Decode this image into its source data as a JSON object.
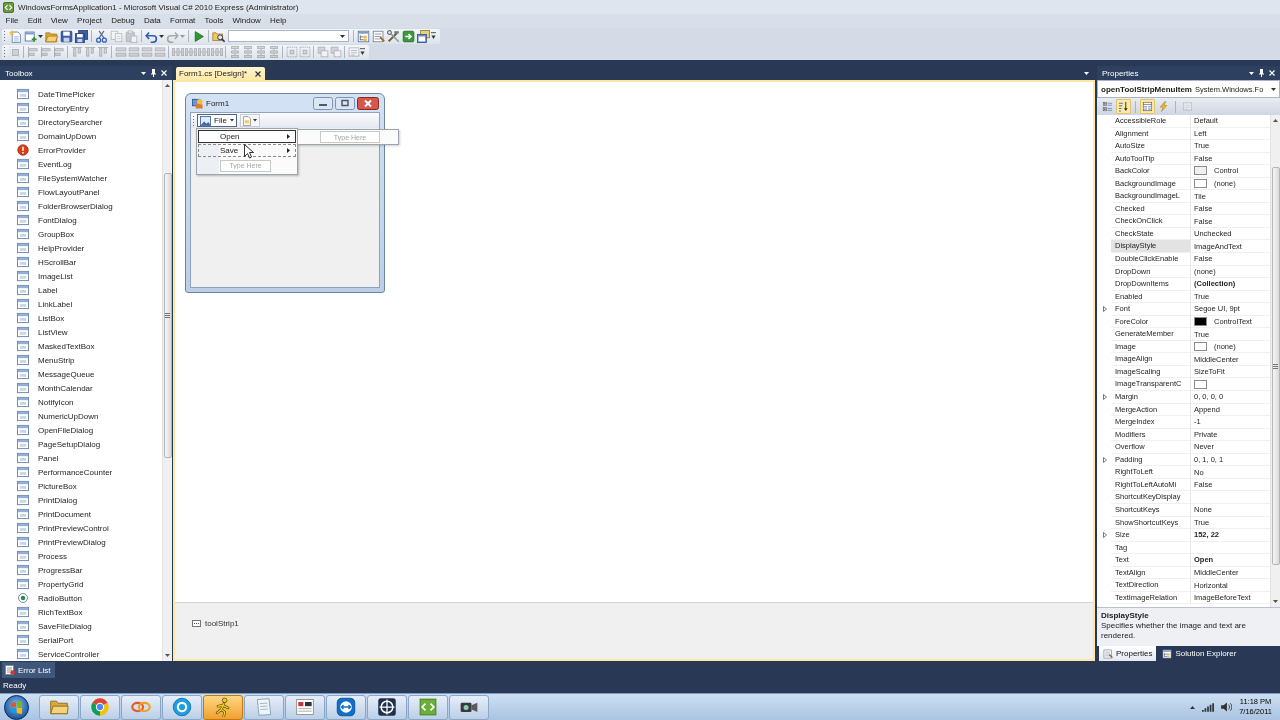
{
  "window": {
    "title": "WindowsFormsApplication1 - Microsoft Visual C# 2010 Express (Administrator)"
  },
  "menu": [
    "File",
    "Edit",
    "View",
    "Project",
    "Debug",
    "Data",
    "Format",
    "Tools",
    "Window",
    "Help"
  ],
  "toolbars": [
    {
      "groups": [
        {
          "buttons": [
            {
              "kind": "newproject",
              "disabled": false
            },
            {
              "kind": "additem",
              "disabled": false
            },
            {
              "kind": "caret",
              "disabled": false
            },
            {
              "kind": "open",
              "disabled": false
            },
            {
              "kind": "save",
              "disabled": false
            },
            {
              "kind": "saveall",
              "disabled": false
            }
          ]
        },
        {
          "buttons": [
            {
              "kind": "cut",
              "disabled": false
            },
            {
              "kind": "copy",
              "disabled": true
            },
            {
              "kind": "paste",
              "disabled": true
            }
          ]
        },
        {
          "buttons": [
            {
              "kind": "undo",
              "disabled": false
            },
            {
              "kind": "caret",
              "disabled": false
            },
            {
              "kind": "redo",
              "disabled": true
            },
            {
              "kind": "caret",
              "disabled": true
            }
          ]
        },
        {
          "buttons": [
            {
              "kind": "start",
              "disabled": false
            }
          ]
        },
        {
          "buttons": [
            {
              "kind": "findfiles",
              "disabled": false
            },
            {
              "kind": "combo",
              "disabled": false
            }
          ]
        },
        {
          "buttons": [
            {
              "kind": "solution",
              "disabled": false
            },
            {
              "kind": "properties",
              "disabled": false
            },
            {
              "kind": "toolbox",
              "disabled": false
            },
            {
              "kind": "extensions",
              "disabled": false
            },
            {
              "kind": "startpage",
              "disabled": false
            },
            {
              "kind": "overflow",
              "disabled": false
            }
          ]
        }
      ]
    },
    {
      "groups": [
        {
          "buttons": [
            {
              "kind": "grid",
              "disabled": true
            }
          ]
        },
        {
          "buttons": [
            {
              "kind": "align",
              "disabled": true
            },
            {
              "kind": "align",
              "disabled": true
            },
            {
              "kind": "align",
              "disabled": true
            }
          ]
        },
        {
          "buttons": [
            {
              "kind": "valign",
              "disabled": true
            },
            {
              "kind": "valign",
              "disabled": true
            },
            {
              "kind": "valign",
              "disabled": true
            }
          ]
        },
        {
          "buttons": [
            {
              "kind": "size",
              "disabled": true
            },
            {
              "kind": "size",
              "disabled": true
            },
            {
              "kind": "size",
              "disabled": true
            },
            {
              "kind": "size",
              "disabled": true
            }
          ]
        },
        {
          "buttons": [
            {
              "kind": "hspace",
              "disabled": true
            },
            {
              "kind": "hspace",
              "disabled": true
            },
            {
              "kind": "hspace",
              "disabled": true
            },
            {
              "kind": "hspace",
              "disabled": true
            }
          ]
        },
        {
          "buttons": [
            {
              "kind": "vspace",
              "disabled": true
            },
            {
              "kind": "vspace",
              "disabled": true
            },
            {
              "kind": "vspace",
              "disabled": true
            },
            {
              "kind": "vspace",
              "disabled": true
            }
          ]
        },
        {
          "buttons": [
            {
              "kind": "center",
              "disabled": true
            },
            {
              "kind": "center",
              "disabled": true
            }
          ]
        },
        {
          "buttons": [
            {
              "kind": "order",
              "disabled": true
            },
            {
              "kind": "order",
              "disabled": true
            }
          ]
        },
        {
          "buttons": [
            {
              "kind": "taborder",
              "disabled": true
            },
            {
              "kind": "overflow",
              "disabled": false
            }
          ]
        }
      ]
    }
  ],
  "toolbox": {
    "title": "Toolbox",
    "items": [
      {
        "label": "DateTimePicker"
      },
      {
        "label": "DirectoryEntry"
      },
      {
        "label": "DirectorySearcher"
      },
      {
        "label": "DomainUpDown"
      },
      {
        "label": "ErrorProvider"
      },
      {
        "label": "EventLog"
      },
      {
        "label": "FileSystemWatcher"
      },
      {
        "label": "FlowLayoutPanel"
      },
      {
        "label": "FolderBrowserDialog"
      },
      {
        "label": "FontDialog"
      },
      {
        "label": "GroupBox"
      },
      {
        "label": "HelpProvider"
      },
      {
        "label": "HScrollBar"
      },
      {
        "label": "ImageList"
      },
      {
        "label": "Label"
      },
      {
        "label": "LinkLabel"
      },
      {
        "label": "ListBox"
      },
      {
        "label": "ListView"
      },
      {
        "label": "MaskedTextBox"
      },
      {
        "label": "MenuStrip"
      },
      {
        "label": "MessageQueue"
      },
      {
        "label": "MonthCalendar"
      },
      {
        "label": "NotifyIcon"
      },
      {
        "label": "NumericUpDown"
      },
      {
        "label": "OpenFileDialog"
      },
      {
        "label": "PageSetupDialog"
      },
      {
        "label": "Panel"
      },
      {
        "label": "PerformanceCounter"
      },
      {
        "label": "PictureBox"
      },
      {
        "label": "PrintDialog"
      },
      {
        "label": "PrintDocument"
      },
      {
        "label": "PrintPreviewControl"
      },
      {
        "label": "PrintPreviewDialog"
      },
      {
        "label": "Process"
      },
      {
        "label": "ProgressBar"
      },
      {
        "label": "PropertyGrid"
      },
      {
        "label": "RadioButton"
      },
      {
        "label": "RichTextBox"
      },
      {
        "label": "SaveFileDialog"
      },
      {
        "label": "SerialPort"
      },
      {
        "label": "ServiceController"
      }
    ]
  },
  "document_tabs": [
    {
      "label": "Form1.cs [Design]*",
      "selected": true
    }
  ],
  "designer": {
    "form": {
      "title": "Form1",
      "menu_strip": {
        "items": [
          {
            "label": "File",
            "selected": true,
            "dropdown": {
              "items": [
                {
                  "label": "Open",
                  "selected": true,
                  "hovered": false,
                  "expanded": true,
                  "submenu_placeholder": "Type Here"
                },
                {
                  "label": "Save",
                  "selected": false,
                  "hovered": true,
                  "expanded": false
                }
              ],
              "placeholder": "Type Here"
            }
          }
        ]
      }
    },
    "tray": [
      {
        "label": "toolStrip1"
      }
    ]
  },
  "properties": {
    "title": "Properties",
    "object": {
      "name": "openToolStripMenuItem",
      "type": "System.Windows.Fo"
    },
    "toolbar": [
      {
        "kind": "categorized",
        "selected": false,
        "disabled": false
      },
      {
        "kind": "alphabetical",
        "selected": true,
        "disabled": false
      },
      {
        "kind": "properties",
        "selected": true,
        "disabled": false
      },
      {
        "kind": "events",
        "selected": false,
        "disabled": false
      },
      {
        "kind": "pages",
        "selected": false,
        "disabled": true
      }
    ],
    "rows": [
      {
        "name": "AccessibleRole",
        "value": "Default",
        "selected": false,
        "modified": false,
        "expandable": false
      },
      {
        "name": "Alignment",
        "value": "Left",
        "selected": false,
        "modified": false,
        "expandable": false
      },
      {
        "name": "AutoSize",
        "value": "True",
        "selected": false,
        "modified": false,
        "expandable": false
      },
      {
        "name": "AutoToolTip",
        "value": "False",
        "selected": false,
        "modified": false,
        "expandable": false
      },
      {
        "name": "BackColor",
        "value": "Control",
        "color": "#f0f0f0",
        "selected": false,
        "modified": false,
        "expandable": false
      },
      {
        "name": "BackgroundImage",
        "value": "(none)",
        "color": "#ffffff",
        "selected": false,
        "modified": false,
        "expandable": false
      },
      {
        "name": "BackgroundImageL",
        "value": "Tile",
        "selected": false,
        "modified": false,
        "expandable": false
      },
      {
        "name": "Checked",
        "value": "False",
        "selected": false,
        "modified": false,
        "expandable": false
      },
      {
        "name": "CheckOnClick",
        "value": "False",
        "selected": false,
        "modified": false,
        "expandable": false
      },
      {
        "name": "CheckState",
        "value": "Unchecked",
        "selected": false,
        "modified": false,
        "expandable": false
      },
      {
        "name": "DisplayStyle",
        "value": "ImageAndText",
        "selected": true,
        "modified": false,
        "expandable": false
      },
      {
        "name": "DoubleClickEnable",
        "value": "False",
        "selected": false,
        "modified": false,
        "expandable": false
      },
      {
        "name": "DropDown",
        "value": "(none)",
        "selected": false,
        "modified": false,
        "expandable": false
      },
      {
        "name": "DropDownItems",
        "value": "(Collection)",
        "selected": false,
        "modified": true,
        "expandable": false
      },
      {
        "name": "Enabled",
        "value": "True",
        "selected": false,
        "modified": false,
        "expandable": false
      },
      {
        "name": "Font",
        "value": "Segoe UI, 9pt",
        "selected": false,
        "modified": false,
        "expandable": true
      },
      {
        "name": "ForeColor",
        "value": "ControlText",
        "color": "#000000",
        "selected": false,
        "modified": false,
        "expandable": false
      },
      {
        "name": "GenerateMember",
        "value": "True",
        "selected": false,
        "modified": false,
        "expandable": false
      },
      {
        "name": "Image",
        "value": "(none)",
        "color": "#ffffff",
        "selected": false,
        "modified": false,
        "expandable": false
      },
      {
        "name": "ImageAlign",
        "value": "MiddleCenter",
        "selected": false,
        "modified": false,
        "expandable": false
      },
      {
        "name": "ImageScaling",
        "value": "SizeToFit",
        "selected": false,
        "modified": false,
        "expandable": false
      },
      {
        "name": "ImageTransparentC",
        "color": "#ffffff",
        "selected": false,
        "expandable": false
      },
      {
        "name": "Margin",
        "value": "0, 0, 0, 0",
        "selected": false,
        "modified": false,
        "expandable": true
      },
      {
        "name": "MergeAction",
        "value": "Append",
        "selected": false,
        "modified": false,
        "expandable": false
      },
      {
        "name": "MergeIndex",
        "value": "-1",
        "selected": false,
        "modified": false,
        "expandable": false
      },
      {
        "name": "Modifiers",
        "value": "Private",
        "selected": false,
        "modified": false,
        "expandable": false
      },
      {
        "name": "Overflow",
        "value": "Never",
        "selected": false,
        "modified": false,
        "expandable": false
      },
      {
        "name": "Padding",
        "value": "0, 1, 0, 1",
        "selected": false,
        "modified": false,
        "expandable": true
      },
      {
        "name": "RightToLeft",
        "value": "No",
        "selected": false,
        "modified": false,
        "expandable": false
      },
      {
        "name": "RightToLeftAutoMi",
        "value": "False",
        "selected": false,
        "modified": false,
        "expandable": false
      },
      {
        "name": "ShortcutKeyDisplay",
        "selected": false,
        "expandable": false
      },
      {
        "name": "ShortcutKeys",
        "value": "None",
        "selected": false,
        "modified": false,
        "expandable": false
      },
      {
        "name": "ShowShortcutKeys",
        "value": "True",
        "selected": false,
        "modified": false,
        "expandable": false
      },
      {
        "name": "Size",
        "value": "152, 22",
        "selected": false,
        "modified": true,
        "expandable": true
      },
      {
        "name": "Tag",
        "selected": false,
        "expandable": false
      },
      {
        "name": "Text",
        "value": "Open",
        "selected": false,
        "modified": true,
        "expandable": false
      },
      {
        "name": "TextAlign",
        "value": "MiddleCenter",
        "selected": false,
        "modified": false,
        "expandable": false
      },
      {
        "name": "TextDirection",
        "value": "Horizontal",
        "selected": false,
        "modified": false,
        "expandable": false
      },
      {
        "name": "TextImageRelation",
        "value": "ImageBeforeText",
        "selected": false,
        "modified": false,
        "expandable": false
      }
    ],
    "description": {
      "title": "DisplayStyle",
      "text": "Specifies whether the image and text are rendered."
    },
    "tabs": [
      {
        "label": "Properties",
        "selected": true
      },
      {
        "label": "Solution Explorer",
        "selected": false
      }
    ]
  },
  "bottom_tabs": [
    {
      "label": "Error List"
    }
  ],
  "status_bar": {
    "text": "Ready"
  },
  "taskbar": {
    "apps": [
      {
        "kind": "folder",
        "highlighted": false
      },
      {
        "kind": "browser",
        "highlighted": false
      },
      {
        "kind": "loops",
        "highlighted": false
      },
      {
        "kind": "chat",
        "highlighted": false
      },
      {
        "kind": "runner",
        "highlighted": true
      },
      {
        "kind": "notes",
        "highlighted": false
      },
      {
        "kind": "hexeditor",
        "highlighted": false
      },
      {
        "kind": "remote",
        "highlighted": false
      },
      {
        "kind": "target",
        "highlighted": false
      },
      {
        "kind": "ide",
        "highlighted": false
      },
      {
        "kind": "camera",
        "highlighted": false
      }
    ],
    "clock": {
      "time": "11:18 PM",
      "date": "7/16/2011"
    }
  }
}
